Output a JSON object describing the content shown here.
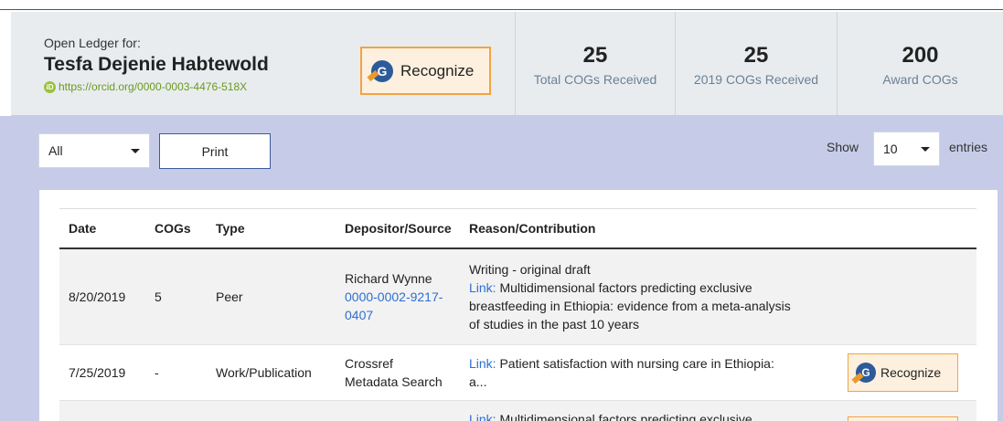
{
  "header": {
    "owner_label": "Open Ledger for:",
    "owner_name": "Tesfa Dejenie Habtewold",
    "orcid_url": "https://orcid.org/0000-0003-4476-518X",
    "recognize_label": "Recognize"
  },
  "stats": [
    {
      "value": "25",
      "label": "Total COGs Received"
    },
    {
      "value": "25",
      "label": "2019 COGs Received"
    },
    {
      "value": "200",
      "label": "Award COGs"
    }
  ],
  "controls": {
    "filter_value": "All",
    "print_label": "Print",
    "show_label": "Show",
    "entries_value": "10",
    "entries_label": "entries"
  },
  "table": {
    "columns": [
      "Date",
      "COGs",
      "Type",
      "Depositor/Source",
      "Reason/Contribution"
    ],
    "rows": [
      {
        "date": "8/20/2019",
        "cogs": "5",
        "type": "Peer",
        "depositor_name": "Richard Wynne",
        "depositor_id_1": "0000-0002-9217-",
        "depositor_id_2": "0407",
        "reason_line1": "Writing - original draft",
        "link_prefix": "Link:",
        "reason_line2": " Multidimensional factors predicting exclusive",
        "reason_line3": "breastfeeding in Ethiopia: evidence from a meta-analysis",
        "reason_line4": "of studies in the past 10 years"
      },
      {
        "date": "7/25/2019",
        "cogs": "-",
        "type": "Work/Publication",
        "depositor_line1": "Crossref",
        "depositor_line2": "Metadata Search",
        "link_prefix": "Link:",
        "reason_line1": " Patient satisfaction with nursing care in Ethiopia:",
        "reason_line2": "a...",
        "action_label": "Recognize"
      },
      {
        "link_prefix": "Link:",
        "reason_line1": " Multidimensional factors predicting exclusive"
      }
    ]
  },
  "colors": {
    "band": "#c6cce8",
    "header_bg": "#e8ecef",
    "recognize_bg": "#fdf0de",
    "recognize_border": "#f0a543",
    "link": "#2c6fd1",
    "orcid_green": "#6a9a1e"
  }
}
